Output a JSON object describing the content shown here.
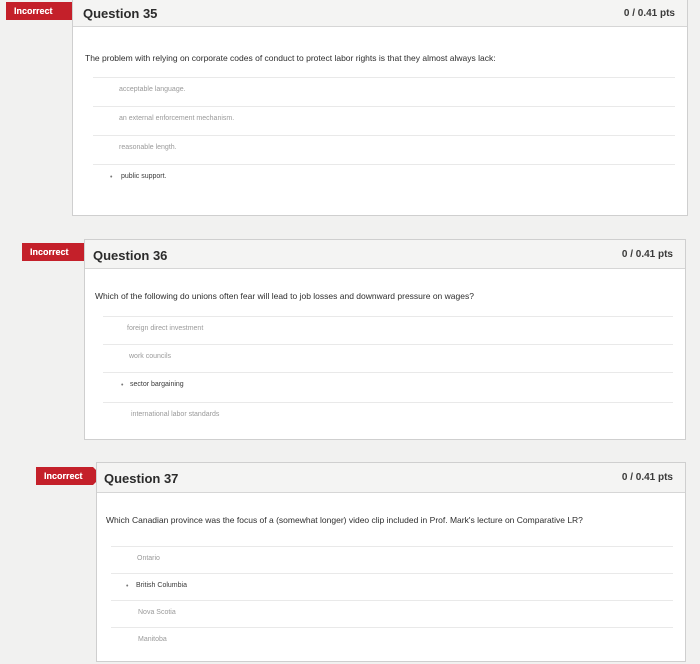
{
  "questions": [
    {
      "status": "Incorrect",
      "title": "Question 35",
      "points": "0 / 0.41 pts",
      "prompt": "The problem with relying on corporate codes of conduct to protect labor rights is that they almost always lack:",
      "answers": [
        {
          "label": "acceptable language.",
          "selected": false
        },
        {
          "label": "an external enforcement mechanism.",
          "selected": false
        },
        {
          "label": "reasonable length.",
          "selected": false
        },
        {
          "label": "public support.",
          "selected": true
        }
      ]
    },
    {
      "status": "Incorrect",
      "title": "Question 36",
      "points": "0 / 0.41 pts",
      "prompt": "Which of the following do unions often fear will lead to job losses and downward pressure on wages?",
      "answers": [
        {
          "label": "foreign direct investment",
          "selected": false
        },
        {
          "label": "work councils",
          "selected": false
        },
        {
          "label": "sector bargaining",
          "selected": true
        },
        {
          "label": "international labor standards",
          "selected": false
        }
      ]
    },
    {
      "status": "Incorrect",
      "title": "Question 37",
      "points": "0 / 0.41 pts",
      "prompt": "Which Canadian province was the focus of a (somewhat longer) video clip included in Prof. Mark's lecture on Comparative LR?",
      "answers": [
        {
          "label": "Ontario",
          "selected": false
        },
        {
          "label": "British Columbia",
          "selected": true
        },
        {
          "label": "Nova Scotia",
          "selected": false
        },
        {
          "label": "Manitoba",
          "selected": false
        }
      ]
    }
  ]
}
